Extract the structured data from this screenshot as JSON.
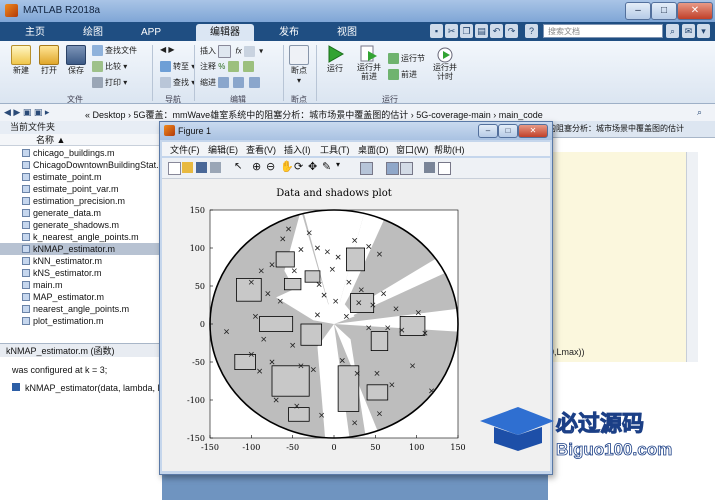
{
  "window": {
    "title": "MATLAB R2018a"
  },
  "ribbon_tabs": [
    "主页",
    "绘图",
    "APP",
    "编辑器",
    "发布",
    "视图"
  ],
  "active_tab": "编辑器",
  "search": {
    "placeholder": "搜索文档"
  },
  "ribbon": {
    "file_group": {
      "new": "新建",
      "open": "打开",
      "save": "保存",
      "find_files": "查找文件",
      "compare": "比较",
      "print": "打印",
      "label": "文件"
    },
    "nav_group": {
      "goto": "转至",
      "find": "查找",
      "label": "导航"
    },
    "edit_group": {
      "insert": "插入",
      "comment": "注释",
      "indent": "缩进",
      "fx": "fx",
      "label": "编辑"
    },
    "breakpoint_group": {
      "breakpoints": "断点",
      "label": "断点"
    },
    "run_group": {
      "run": "运行",
      "run_advance": "运行并\n前进",
      "run_section": "运行节",
      "advance": "前进",
      "run_time": "运行并\n计时",
      "label": "运行"
    }
  },
  "address_bar": {
    "path": "« Desktop › 5G覆盖：mmWave雄室系统中的阻塞分析：城市场景中覆盖图的估计 › 5G-coverage-main › main_code"
  },
  "file_browser": {
    "header": "当前文件夹",
    "column": "名称 ▲",
    "files": [
      "chicago_buildings.m",
      "ChicagoDowntownBuildingStat...",
      "estimate_point.m",
      "estimate_point_var.m",
      "estimation_precision.m",
      "generate_data.m",
      "generate_shadows.m",
      "k_nearest_angle_points.m",
      "kNMAP_estimator.m",
      "kNN_estimator.m",
      "kNS_estimator.m",
      "main.m",
      "MAP_estimator.m",
      "nearest_angle_points.m",
      "plot_estimation.m"
    ],
    "selected_index": 8
  },
  "details": {
    "label": "kNMAP_estimator.m (函数)"
  },
  "command_window": {
    "line1": "was configured at k = 3;",
    "line2": "kNMAP_estimator(data, lambda, l"
  },
  "editor": {
    "tab_text": "的阻塞分析：城市场景中覆盖图的估计",
    "code_fragment": "0,Lmax))"
  },
  "figure": {
    "title": "Figure 1",
    "menu": [
      "文件(F)",
      "编辑(E)",
      "查看(V)",
      "插入(I)",
      "工具(T)",
      "桌面(D)",
      "窗口(W)",
      "帮助(H)"
    ]
  },
  "chart_data": {
    "type": "scatter",
    "title": "Data and shadows plot",
    "xlabel": "",
    "ylabel": "",
    "xlim": [
      -150,
      150
    ],
    "ylim": [
      -150,
      150
    ],
    "xticks": [
      -150,
      -100,
      -50,
      0,
      50,
      100,
      150
    ],
    "yticks": [
      150,
      100,
      50,
      0,
      -50,
      -100,
      -150
    ],
    "circle_radius": 150,
    "colors": {
      "shadow": "#bdbdbd",
      "outline": "#000000",
      "background": "#ffffff"
    },
    "points": [
      [
        -55,
        125
      ],
      [
        -30,
        120
      ],
      [
        -62,
        112
      ],
      [
        -40,
        98
      ],
      [
        -75,
        78
      ],
      [
        -48,
        70
      ],
      [
        -88,
        70
      ],
      [
        -100,
        55
      ],
      [
        -80,
        40
      ],
      [
        -65,
        30
      ],
      [
        -20,
        100
      ],
      [
        -8,
        95
      ],
      [
        5,
        88
      ],
      [
        25,
        110
      ],
      [
        42,
        102
      ],
      [
        55,
        92
      ],
      [
        -2,
        72
      ],
      [
        -18,
        52
      ],
      [
        18,
        55
      ],
      [
        33,
        45
      ],
      [
        -12,
        38
      ],
      [
        2,
        30
      ],
      [
        30,
        28
      ],
      [
        47,
        25
      ],
      [
        60,
        40
      ],
      [
        75,
        20
      ],
      [
        102,
        15
      ],
      [
        82,
        -8
      ],
      [
        -95,
        10
      ],
      [
        -85,
        -20
      ],
      [
        -50,
        -28
      ],
      [
        -20,
        12
      ],
      [
        15,
        10
      ],
      [
        42,
        -5
      ],
      [
        65,
        -5
      ],
      [
        110,
        -12
      ],
      [
        -100,
        -40
      ],
      [
        -75,
        -50
      ],
      [
        -90,
        -62
      ],
      [
        -40,
        -55
      ],
      [
        -25,
        -60
      ],
      [
        10,
        -48
      ],
      [
        28,
        -65
      ],
      [
        52,
        -65
      ],
      [
        70,
        -80
      ],
      [
        -70,
        -100
      ],
      [
        -45,
        -108
      ],
      [
        -15,
        -120
      ],
      [
        25,
        -130
      ],
      [
        55,
        -118
      ],
      [
        118,
        -88
      ],
      [
        95,
        -55
      ],
      [
        -130,
        -10
      ]
    ]
  }
}
